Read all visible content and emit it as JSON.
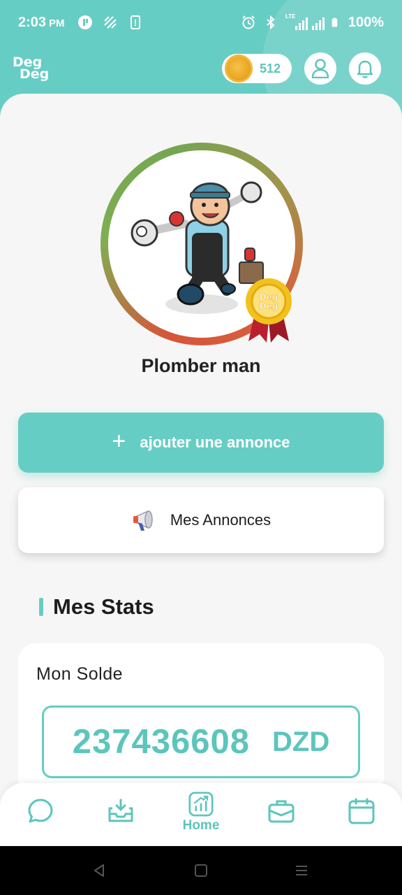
{
  "status_bar": {
    "time": "2:03",
    "ampm": "PM",
    "network": "LTE",
    "battery": "100%",
    "left_icons": [
      "messenger-icon",
      "sync-off-icon",
      "phone-notification-icon"
    ],
    "right_icons": [
      "alarm-icon",
      "bluetooth-icon",
      "signal-icon",
      "battery-icon"
    ]
  },
  "header": {
    "logo_line1": "Deg",
    "logo_line2": "Deg",
    "coins": "512",
    "icons": [
      "coin-icon",
      "user-icon",
      "bell-icon"
    ]
  },
  "profile": {
    "name": "Plomber man",
    "badge_text": "Deg Deg",
    "ring_colors": [
      "#7fae52",
      "#d6553a"
    ]
  },
  "actions": {
    "add_label": "ajouter une annonce",
    "ads_label": "Mes Annonces"
  },
  "stats": {
    "title": "Mes Stats",
    "balance_label": "Mon Solde",
    "balance_amount": "237436608",
    "currency": "DZD"
  },
  "bottom_nav": {
    "items": [
      {
        "icon": "chat-icon",
        "label": ""
      },
      {
        "icon": "inbox-download-icon",
        "label": ""
      },
      {
        "icon": "chart-icon",
        "label": "Home",
        "active": true
      },
      {
        "icon": "briefcase-icon",
        "label": ""
      },
      {
        "icon": "calendar-icon",
        "label": ""
      }
    ]
  },
  "colors": {
    "accent": "#66cdc4",
    "accent_text": "#5cc5bc",
    "background": "#f6f6f6"
  }
}
